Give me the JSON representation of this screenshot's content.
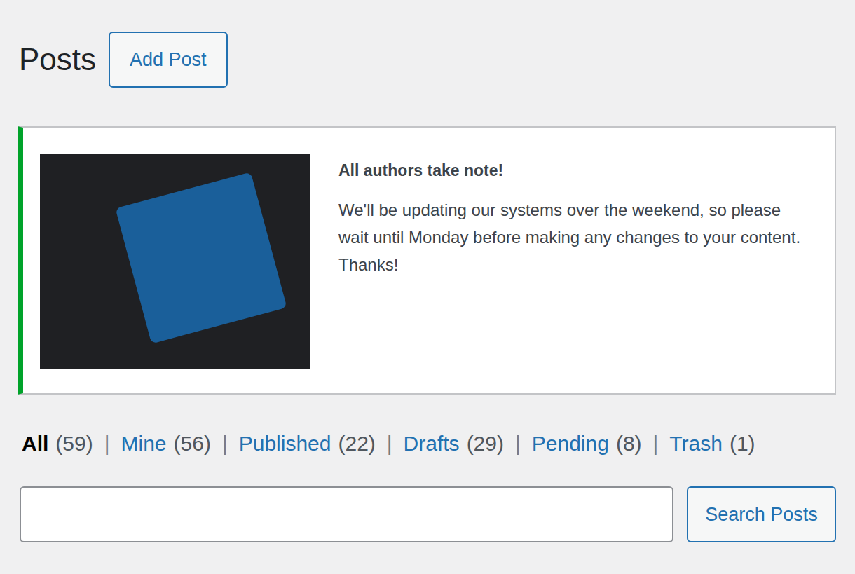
{
  "page": {
    "title": "Posts",
    "add_button": "Add Post"
  },
  "notice": {
    "title": "All authors take note!",
    "message": "We'll be updating our systems over the weekend, so please wait until Monday before making any changes to your content. Thanks!"
  },
  "filters": [
    {
      "label": "All",
      "count": "(59)",
      "selected": true
    },
    {
      "label": "Mine",
      "count": "(56)",
      "selected": false
    },
    {
      "label": "Published",
      "count": "(22)",
      "selected": false
    },
    {
      "label": "Drafts",
      "count": "(29)",
      "selected": false
    },
    {
      "label": "Pending",
      "count": "(8)",
      "selected": false
    },
    {
      "label": "Trash",
      "count": "(1)",
      "selected": false
    }
  ],
  "separator": "|",
  "search": {
    "button": "Search Posts"
  }
}
